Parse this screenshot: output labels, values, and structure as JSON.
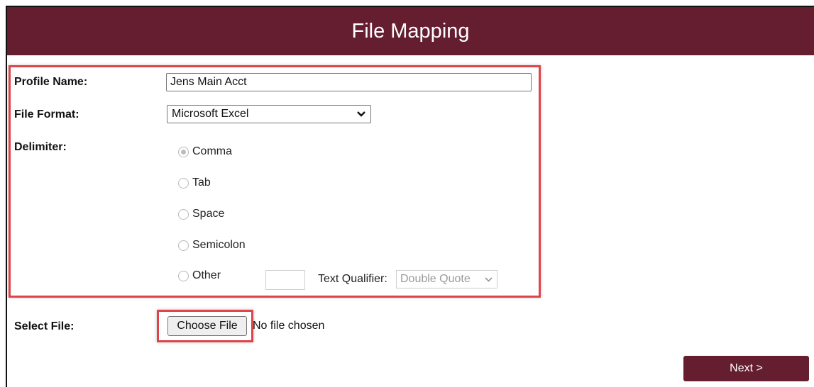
{
  "header": {
    "title": "File Mapping"
  },
  "form": {
    "profile_name_label": "Profile Name:",
    "profile_name_value": "Jens Main Acct",
    "file_format_label": "File Format:",
    "file_format_value": "Microsoft Excel",
    "delimiter_label": "Delimiter:",
    "delimiters": [
      {
        "label": "Comma",
        "selected": true
      },
      {
        "label": "Tab",
        "selected": false
      },
      {
        "label": "Space",
        "selected": false
      },
      {
        "label": "Semicolon",
        "selected": false
      },
      {
        "label": "Other",
        "selected": false
      }
    ],
    "other_value": "",
    "text_qualifier_label": "Text Qualifier:",
    "text_qualifier_value": "Double Quote"
  },
  "file": {
    "label": "Select File:",
    "choose_button": "Choose File",
    "status": "No file chosen"
  },
  "actions": {
    "next_label": "Next >"
  },
  "colors": {
    "accent": "#641e30",
    "highlight": "#e0434a"
  },
  "icons": {
    "select_arrow": "chevron-down-icon"
  }
}
